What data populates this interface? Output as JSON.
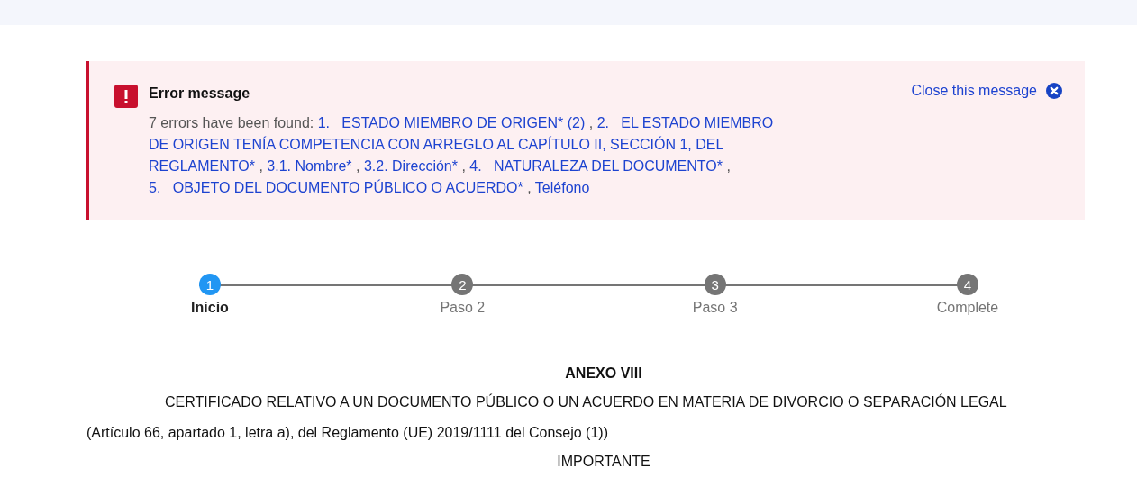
{
  "alert": {
    "title": "Error message",
    "intro": "7 errors have been found:",
    "separator": ",",
    "close_label": "Close this message",
    "errors": [
      "1.   ESTADO MIEMBRO DE ORIGEN* (2)",
      "2.   EL ESTADO MIEMBRO DE ORIGEN TENÍA COMPETENCIA CON ARREGLO AL CAPÍTULO II, SECCIÓN 1, DEL REGLAMENTO*",
      "3.1. Nombre*",
      "3.2. Dirección*",
      "4.   NATURALEZA DEL DOCUMENTO*",
      "5.   OBJETO DEL DOCUMENTO PÚBLICO O ACUERDO*",
      "Teléfono"
    ]
  },
  "steps": [
    {
      "number": "1",
      "label": "Inicio",
      "selected": true
    },
    {
      "number": "2",
      "label": "Paso 2",
      "selected": false
    },
    {
      "number": "3",
      "label": "Paso 3",
      "selected": false
    },
    {
      "number": "4",
      "label": "Complete",
      "selected": false
    }
  ],
  "document": {
    "annex": "ANEXO VIII",
    "title": "CERTIFICADO RELATIVO A UN DOCUMENTO PÚBLICO O UN ACUERDO EN MATERIA DE DIVORCIO O SEPARACIÓN LEGAL",
    "reference": "(Artículo 66, apartado 1, letra a), del Reglamento (UE) 2019/1111 del Consejo (1))",
    "notice": "IMPORTANTE"
  }
}
